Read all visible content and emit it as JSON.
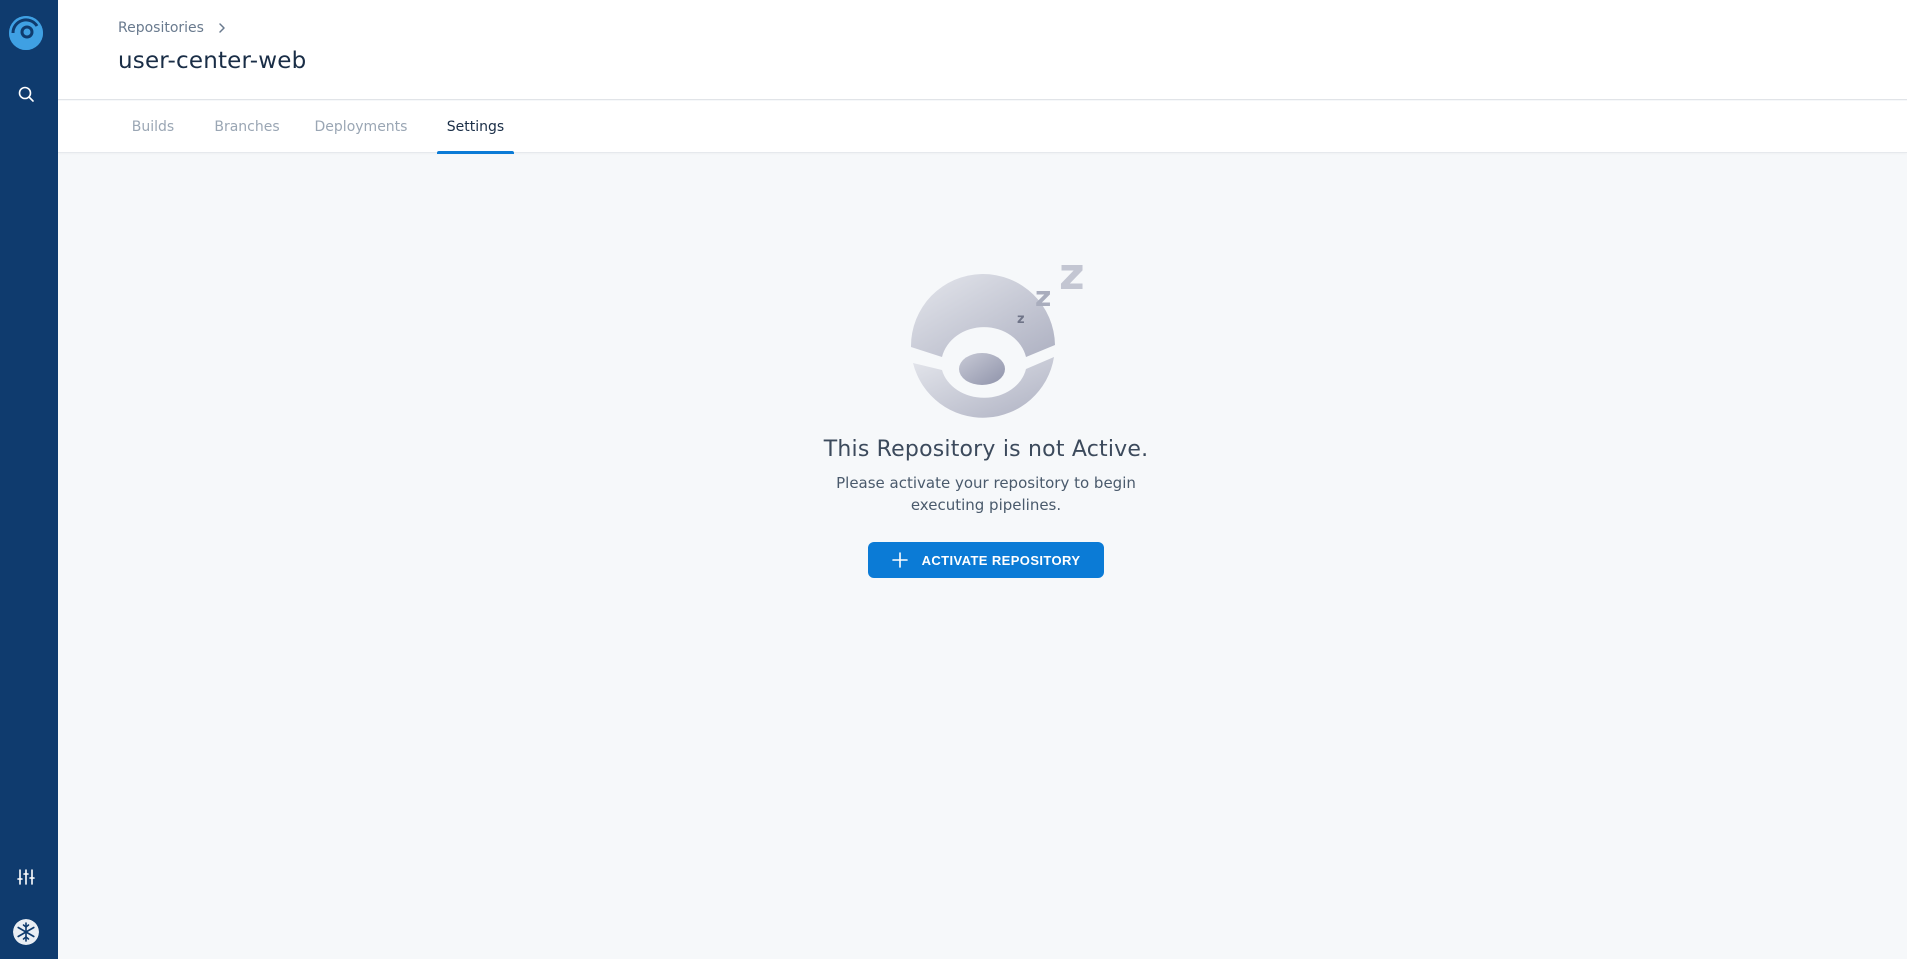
{
  "sidebar": {
    "logo_icon": "drone-logo-icon",
    "search_icon": "search-icon",
    "settings_icon": "sliders-icon",
    "avatar_icon": "snowflake-avatar-icon"
  },
  "header": {
    "breadcrumb": "Repositories",
    "title": "user-center-web"
  },
  "tabs": [
    {
      "label": "Builds"
    },
    {
      "label": "Branches"
    },
    {
      "label": "Deployments"
    },
    {
      "label": "Settings"
    }
  ],
  "active_tab": "Settings",
  "empty_state": {
    "illustration_icon": "sleeping-drone-icon",
    "title": "This Repository is not Active.",
    "description": "Please activate your repository to begin executing pipelines.",
    "button_label": "ACTIVATE REPOSITORY",
    "button_icon": "plus-icon"
  },
  "colors": {
    "sidebar": "#0f3b6e",
    "accent": "#0b7bd6",
    "background": "#f6f8fa"
  }
}
